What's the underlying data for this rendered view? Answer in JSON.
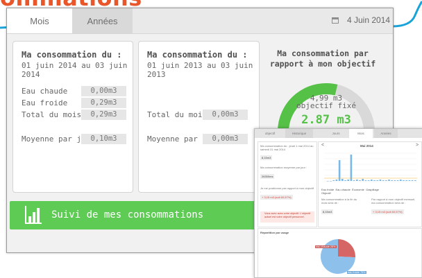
{
  "banner": {
    "title": "ommations"
  },
  "tabs": [
    {
      "label": "Mois",
      "active": true
    },
    {
      "label": "Années",
      "active": false
    }
  ],
  "date": {
    "icon": "calendar-icon",
    "label": "4 Juin 2014"
  },
  "card_current": {
    "title": "Ma consommation du :",
    "range": "01 juin 2014 au 03 juin 2014",
    "rows": [
      {
        "label": "Eau chaude",
        "value": "0,00m3"
      },
      {
        "label": "Eau froide",
        "value": "0,29m3"
      },
      {
        "label": "Total du mois",
        "value": "0,29m3"
      }
    ],
    "average": {
      "label": "Moyenne par jour",
      "value": "0,10m3"
    }
  },
  "card_previous": {
    "title": "Ma consommation du :",
    "range": "01 juin 2013 au 03 juin 2013",
    "total": {
      "label": "Total du mois",
      "value": "0,00m3"
    },
    "average": {
      "label": "Moyenne par jour",
      "value": "0,00m3"
    }
  },
  "objective": {
    "title": "Ma consommation par rapport à mon objectif",
    "target_value": "4,99 m3",
    "target_label": "objectif fixé",
    "current": "2.87 m3",
    "progress_fraction": 0.575,
    "colors": {
      "progress": "#55c147",
      "track": "#d9d9d9"
    }
  },
  "followup": {
    "label": "Suivi de mes consommations",
    "icon": "bar-chart-icon",
    "color": "#5ecb55"
  },
  "inset": {
    "tabs": [
      {
        "label": "objectif",
        "active": false
      },
      {
        "label": "Historique",
        "active": false
      },
      {
        "label": "Jours",
        "active": false
      },
      {
        "label": "Mois",
        "active": true
      },
      {
        "label": "Années",
        "active": false
      }
    ],
    "left": {
      "period_text": "Ma consommation du : jeudi 1 mai 2014 au samedi 31 mai 2014",
      "period_value": "8,15m3",
      "avg_text": "Ma consommation moyenne par jour :",
      "avg_value": "26300ms",
      "where_text": "Je me positionne par rapport à mon objectif :",
      "where_value": "+ 3,15 m3 (soit 60,57%)",
      "note": "Vous avez avez votre objectif. L'objectif actuel est votre objectif personnel."
    },
    "chart": {
      "month": "Mai 2014",
      "prev": "<",
      "next": ">",
      "legend": [
        "Eau froide",
        "Eau chaude",
        "Économie",
        "Gaspillage",
        "Objectif"
      ],
      "colors": {
        "froide": "#7ab8e8",
        "chaude": "#e57373",
        "economie": "#a0c93a",
        "gaspillage": "#f2b134",
        "objectif": "#c9c9c9"
      },
      "end_month_text": "Ma consommation à la fin du mois sera de :",
      "end_month_value": "8,15m3",
      "vs_obj_text": "Par rapport à mon objectif mensuel, ma consommation sera de :",
      "vs_obj_value": "+ 3,15 m3 (soit 60,57%)"
    },
    "repartition": {
      "title": "Répartition par usage",
      "slices": [
        {
          "label": "eau chaude 26%",
          "value": 26,
          "color": "#d66565"
        },
        {
          "label": "eau froide 75%",
          "value": 75,
          "color": "#8dc0ea"
        }
      ]
    }
  }
}
